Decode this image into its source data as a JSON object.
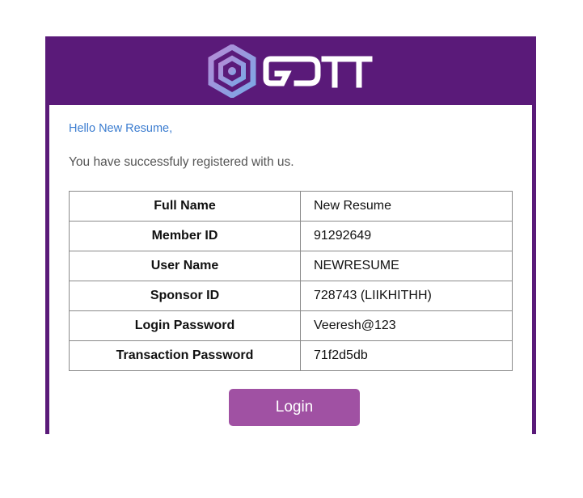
{
  "brand": {
    "logo_text": "GDTT",
    "colors": {
      "frame": "#5a1a79",
      "greeting": "#3c7dd0",
      "button": "#a051a3"
    }
  },
  "greeting": "Hello New Resume,",
  "intro": "You have successfuly registered with us.",
  "details": [
    {
      "label": "Full Name",
      "value": "New Resume"
    },
    {
      "label": "Member ID",
      "value": "91292649"
    },
    {
      "label": "User Name",
      "value": "NEWRESUME"
    },
    {
      "label": "Sponsor ID",
      "value": "728743 (LIIKHITHH)"
    },
    {
      "label": "Login Password",
      "value": "Veeresh@123"
    },
    {
      "label": "Transaction Password",
      "value": "71f2d5db"
    }
  ],
  "login_button": "Login"
}
